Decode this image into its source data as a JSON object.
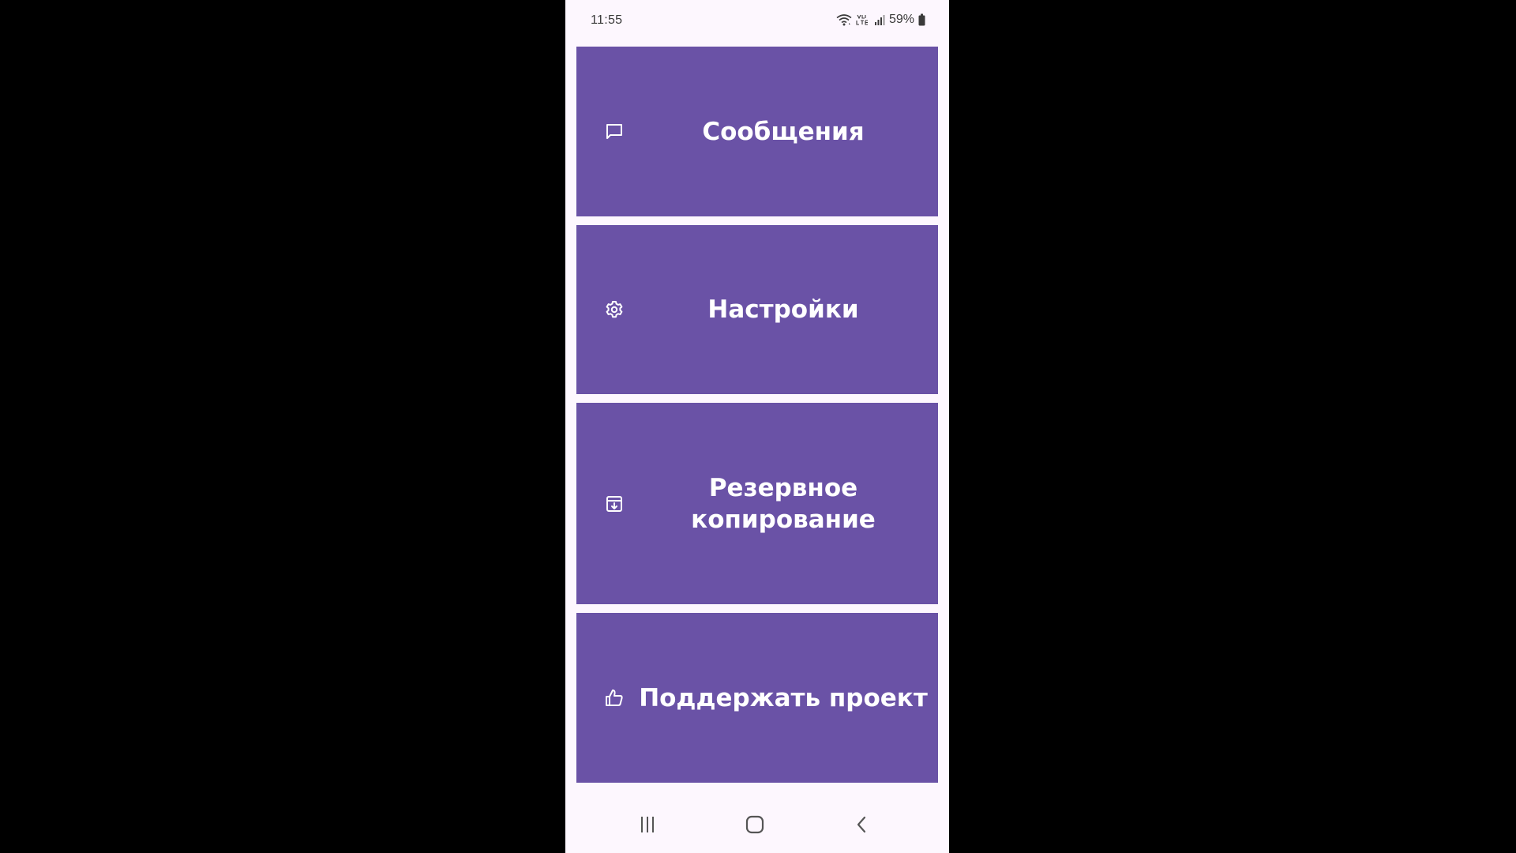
{
  "status_bar": {
    "time": "11:55",
    "battery": "59%",
    "icons": [
      "wifi-icon",
      "volte-lte-icon",
      "signal-icon",
      "battery-icon"
    ]
  },
  "menu": {
    "items": [
      {
        "label": "Сообщения",
        "icon": "chat-bubble-icon"
      },
      {
        "label": "Настройки",
        "icon": "gear-icon"
      },
      {
        "label": "Резервное копирование",
        "icon": "archive-download-icon"
      },
      {
        "label": "Поддержать проект",
        "icon": "thumbs-up-icon"
      }
    ]
  },
  "nav_bar": {
    "icons": [
      "recents-icon",
      "home-icon",
      "back-icon"
    ]
  },
  "colors": {
    "tile_background": "#6a52a6",
    "screen_background": "#fdf7fe",
    "tile_text": "#ffffff",
    "outside_background": "#000000"
  }
}
